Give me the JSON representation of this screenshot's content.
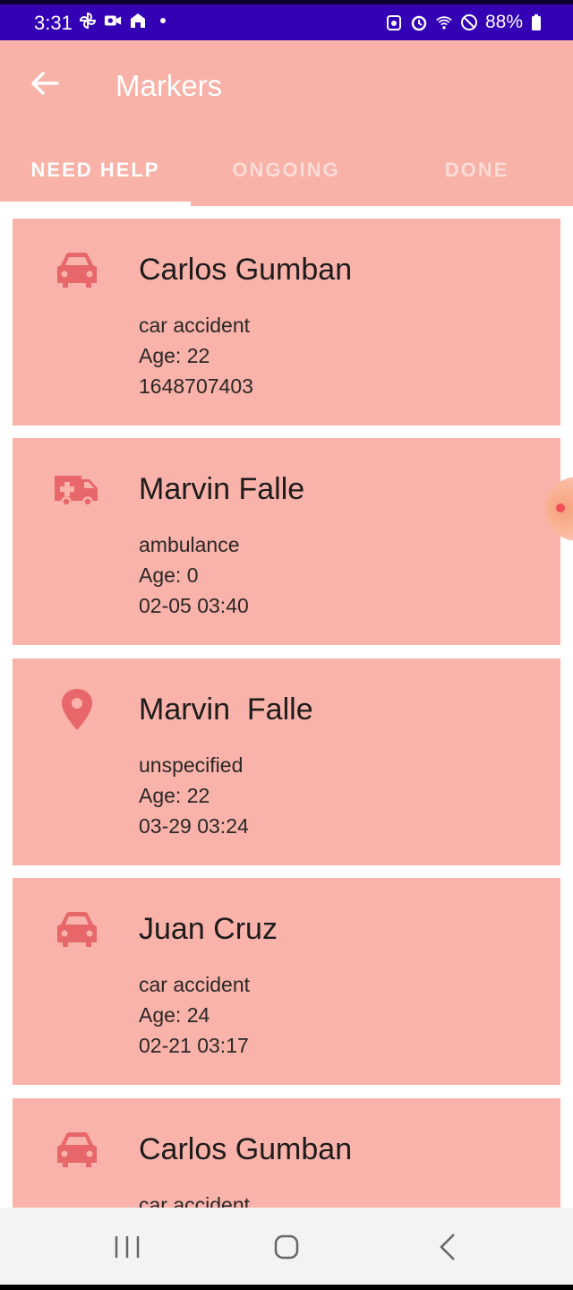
{
  "status_bar": {
    "time": "3:31",
    "battery": "88%",
    "left_icons": [
      "pinwheel-icon",
      "video-icon",
      "home-icon",
      "dot-icon"
    ],
    "right_icons": [
      "recycle-icon",
      "alarm-icon",
      "wifi-icon",
      "do-not-disturb-icon",
      "battery-icon"
    ]
  },
  "app_bar": {
    "title": "Markers",
    "back_icon": "arrow-left-icon",
    "color": "#f8b2a8"
  },
  "tabs": [
    {
      "label": "NEED HELP",
      "selected": true
    },
    {
      "label": "ONGOING",
      "selected": false
    },
    {
      "label": "DONE",
      "selected": false
    }
  ],
  "markers": [
    {
      "icon": "car-icon",
      "name": "Carlos Gumban",
      "type": "car accident",
      "age": "Age: 22",
      "time": "1648707403"
    },
    {
      "icon": "ambulance-icon",
      "name": "Marvin Falle",
      "type": "ambulance",
      "age": "Age: 0",
      "time": "02-05 03:40"
    },
    {
      "icon": "location-pin-icon",
      "name": "Marvin  Falle",
      "type": "unspecified",
      "age": "Age: 22",
      "time": "03-29 03:24"
    },
    {
      "icon": "car-icon",
      "name": "Juan Cruz",
      "type": "car accident",
      "age": "Age: 24",
      "time": "02-21 03:17"
    },
    {
      "icon": "car-icon",
      "name": "Carlos Gumban",
      "type": "car accident",
      "age": "",
      "time": ""
    }
  ],
  "colors": {
    "card_background": "#f9b3aa",
    "icon_color": "#e8676a",
    "status_bar": "#3300b4"
  },
  "nav_bar": {
    "buttons": [
      "recent-apps-icon",
      "home-button-icon",
      "back-chevron-icon"
    ]
  }
}
